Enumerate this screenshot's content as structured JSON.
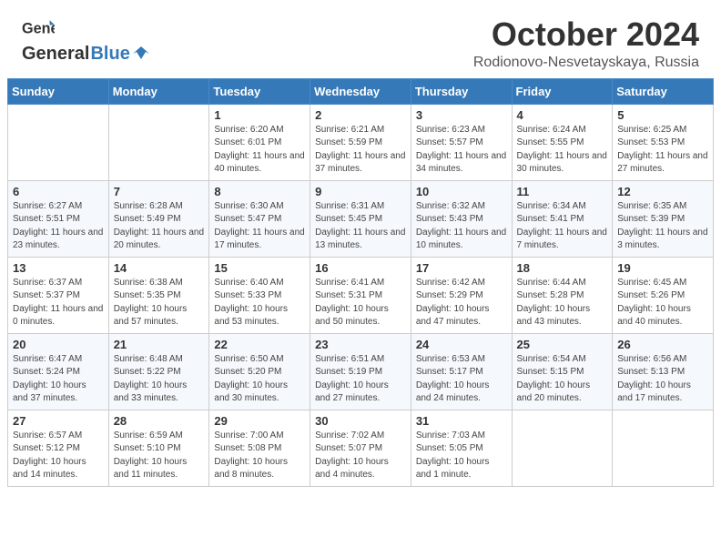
{
  "header": {
    "logo_general": "General",
    "logo_blue": "Blue",
    "month_title": "October 2024",
    "location": "Rodionovo-Nesvetayskaya, Russia"
  },
  "weekdays": [
    "Sunday",
    "Monday",
    "Tuesday",
    "Wednesday",
    "Thursday",
    "Friday",
    "Saturday"
  ],
  "weeks": [
    [
      {
        "day": "",
        "info": ""
      },
      {
        "day": "",
        "info": ""
      },
      {
        "day": "1",
        "info": "Sunrise: 6:20 AM\nSunset: 6:01 PM\nDaylight: 11 hours and 40 minutes."
      },
      {
        "day": "2",
        "info": "Sunrise: 6:21 AM\nSunset: 5:59 PM\nDaylight: 11 hours and 37 minutes."
      },
      {
        "day": "3",
        "info": "Sunrise: 6:23 AM\nSunset: 5:57 PM\nDaylight: 11 hours and 34 minutes."
      },
      {
        "day": "4",
        "info": "Sunrise: 6:24 AM\nSunset: 5:55 PM\nDaylight: 11 hours and 30 minutes."
      },
      {
        "day": "5",
        "info": "Sunrise: 6:25 AM\nSunset: 5:53 PM\nDaylight: 11 hours and 27 minutes."
      }
    ],
    [
      {
        "day": "6",
        "info": "Sunrise: 6:27 AM\nSunset: 5:51 PM\nDaylight: 11 hours and 23 minutes."
      },
      {
        "day": "7",
        "info": "Sunrise: 6:28 AM\nSunset: 5:49 PM\nDaylight: 11 hours and 20 minutes."
      },
      {
        "day": "8",
        "info": "Sunrise: 6:30 AM\nSunset: 5:47 PM\nDaylight: 11 hours and 17 minutes."
      },
      {
        "day": "9",
        "info": "Sunrise: 6:31 AM\nSunset: 5:45 PM\nDaylight: 11 hours and 13 minutes."
      },
      {
        "day": "10",
        "info": "Sunrise: 6:32 AM\nSunset: 5:43 PM\nDaylight: 11 hours and 10 minutes."
      },
      {
        "day": "11",
        "info": "Sunrise: 6:34 AM\nSunset: 5:41 PM\nDaylight: 11 hours and 7 minutes."
      },
      {
        "day": "12",
        "info": "Sunrise: 6:35 AM\nSunset: 5:39 PM\nDaylight: 11 hours and 3 minutes."
      }
    ],
    [
      {
        "day": "13",
        "info": "Sunrise: 6:37 AM\nSunset: 5:37 PM\nDaylight: 11 hours and 0 minutes."
      },
      {
        "day": "14",
        "info": "Sunrise: 6:38 AM\nSunset: 5:35 PM\nDaylight: 10 hours and 57 minutes."
      },
      {
        "day": "15",
        "info": "Sunrise: 6:40 AM\nSunset: 5:33 PM\nDaylight: 10 hours and 53 minutes."
      },
      {
        "day": "16",
        "info": "Sunrise: 6:41 AM\nSunset: 5:31 PM\nDaylight: 10 hours and 50 minutes."
      },
      {
        "day": "17",
        "info": "Sunrise: 6:42 AM\nSunset: 5:29 PM\nDaylight: 10 hours and 47 minutes."
      },
      {
        "day": "18",
        "info": "Sunrise: 6:44 AM\nSunset: 5:28 PM\nDaylight: 10 hours and 43 minutes."
      },
      {
        "day": "19",
        "info": "Sunrise: 6:45 AM\nSunset: 5:26 PM\nDaylight: 10 hours and 40 minutes."
      }
    ],
    [
      {
        "day": "20",
        "info": "Sunrise: 6:47 AM\nSunset: 5:24 PM\nDaylight: 10 hours and 37 minutes."
      },
      {
        "day": "21",
        "info": "Sunrise: 6:48 AM\nSunset: 5:22 PM\nDaylight: 10 hours and 33 minutes."
      },
      {
        "day": "22",
        "info": "Sunrise: 6:50 AM\nSunset: 5:20 PM\nDaylight: 10 hours and 30 minutes."
      },
      {
        "day": "23",
        "info": "Sunrise: 6:51 AM\nSunset: 5:19 PM\nDaylight: 10 hours and 27 minutes."
      },
      {
        "day": "24",
        "info": "Sunrise: 6:53 AM\nSunset: 5:17 PM\nDaylight: 10 hours and 24 minutes."
      },
      {
        "day": "25",
        "info": "Sunrise: 6:54 AM\nSunset: 5:15 PM\nDaylight: 10 hours and 20 minutes."
      },
      {
        "day": "26",
        "info": "Sunrise: 6:56 AM\nSunset: 5:13 PM\nDaylight: 10 hours and 17 minutes."
      }
    ],
    [
      {
        "day": "27",
        "info": "Sunrise: 6:57 AM\nSunset: 5:12 PM\nDaylight: 10 hours and 14 minutes."
      },
      {
        "day": "28",
        "info": "Sunrise: 6:59 AM\nSunset: 5:10 PM\nDaylight: 10 hours and 11 minutes."
      },
      {
        "day": "29",
        "info": "Sunrise: 7:00 AM\nSunset: 5:08 PM\nDaylight: 10 hours and 8 minutes."
      },
      {
        "day": "30",
        "info": "Sunrise: 7:02 AM\nSunset: 5:07 PM\nDaylight: 10 hours and 4 minutes."
      },
      {
        "day": "31",
        "info": "Sunrise: 7:03 AM\nSunset: 5:05 PM\nDaylight: 10 hours and 1 minute."
      },
      {
        "day": "",
        "info": ""
      },
      {
        "day": "",
        "info": ""
      }
    ]
  ]
}
